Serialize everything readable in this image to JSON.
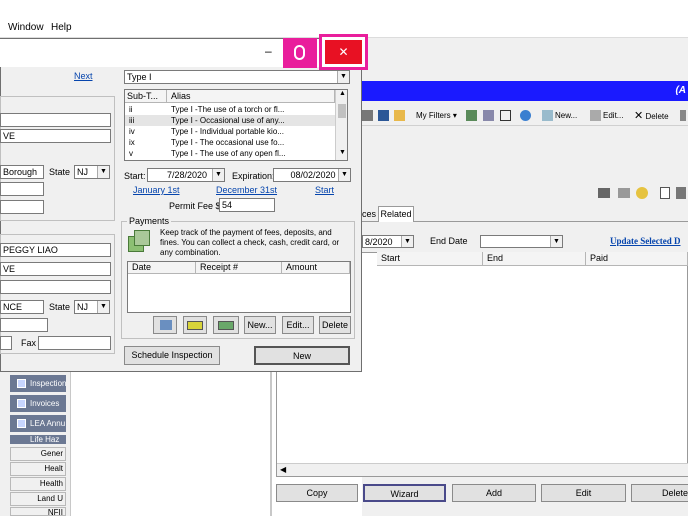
{
  "menubar": {
    "window": "Window",
    "help": "Help"
  },
  "main_window": {
    "title_fragment": "(A",
    "toolbar": {
      "my_filters": "My Filters ▾",
      "new": "New...",
      "edit": "Edit...",
      "delete": "Delete"
    },
    "tabs": {
      "partial": "ces",
      "related": "Related"
    },
    "filter": {
      "start_date_partial": "8/2020",
      "end_date_label": "End Date",
      "end_date_value": "",
      "update_link": "Update Selected D"
    },
    "columns": [
      "Start",
      "End",
      "Paid"
    ],
    "buttons": [
      "Copy",
      "Wizard",
      "Add",
      "Edit",
      "Delete"
    ]
  },
  "sidebar": {
    "items": [
      "Inspection",
      "Invoices",
      "LEA Annu",
      "Life Haz"
    ],
    "groups": [
      "Gener",
      "Healt",
      "Health",
      "Land U",
      "NFII"
    ]
  },
  "left_form": {
    "next_link": "Next",
    "addr1": "VE",
    "borough": "Borough",
    "state_label": "State",
    "state_value": "NJ",
    "owner_name": "PEGGY LIAO",
    "addr2": "VE",
    "city2": "NCE",
    "state2_label": "State",
    "state2_value": "NJ",
    "fax_label": "Fax"
  },
  "permit_dialog": {
    "type_value": "Type I",
    "list_headers": [
      "Sub-T...",
      "Alias"
    ],
    "list_rows": [
      {
        "sub": "ii",
        "alias": "Type I -The use of a torch or fl...",
        "selected": false
      },
      {
        "sub": "iii",
        "alias": "Type I - Occasional use of any...",
        "selected": true
      },
      {
        "sub": "iv",
        "alias": "Type I - Individual portable kio...",
        "selected": false
      },
      {
        "sub": "ix",
        "alias": "Type I - The occasional use fo...",
        "selected": false
      },
      {
        "sub": "v",
        "alias": "Type I - The use of any open fl...",
        "selected": false
      }
    ],
    "start_label": "Start:",
    "start_value": "7/28/2020",
    "expiration_label": "Expiration:",
    "expiration_value": "08/02/2020",
    "link_jan": "January 1st",
    "link_dec": "December 31st",
    "link_start": "Start",
    "permit_fee_label": "Permit Fee $",
    "permit_fee_value": "54",
    "payments_title": "Payments",
    "payments_desc": "Keep track of the payment of fees, deposits, and fines. You can collect a check, cash, credit card, or any combination.",
    "payment_columns": [
      "Date",
      "Receipt #",
      "Amount"
    ],
    "pay_new": "New...",
    "pay_edit": "Edit...",
    "pay_delete": "Delete",
    "schedule_inspection": "Schedule Inspection",
    "new_button": "New"
  },
  "colors": {
    "close_red": "#e81123",
    "highlight_magenta": "#e91e9c",
    "title_blue": "#1a1aff",
    "sidebar_bg": "#6b7893"
  }
}
